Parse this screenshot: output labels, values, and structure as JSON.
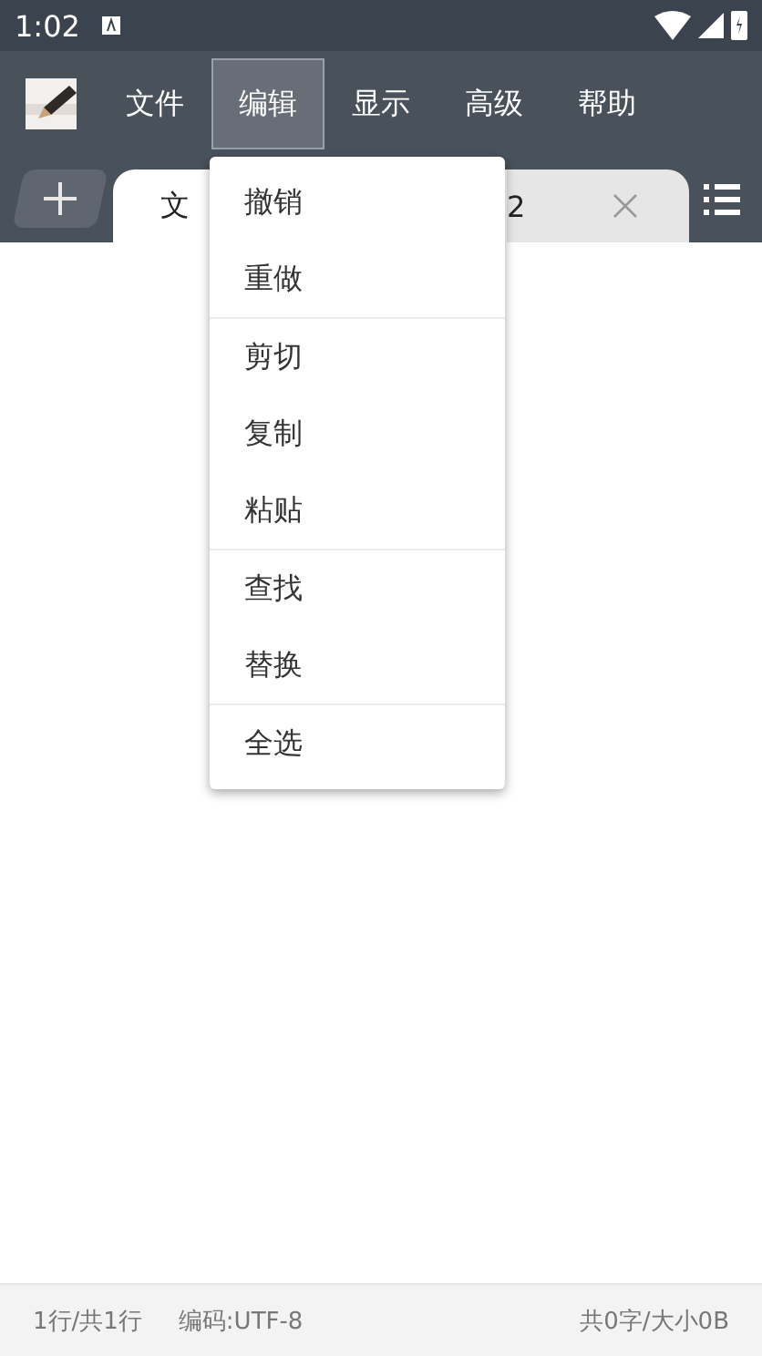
{
  "status_bar": {
    "time": "1:02"
  },
  "menu_bar": {
    "items": [
      {
        "label": "文件",
        "selected": false
      },
      {
        "label": "编辑",
        "selected": true
      },
      {
        "label": "显示",
        "selected": false
      },
      {
        "label": "高级",
        "selected": false
      },
      {
        "label": "帮助",
        "selected": false
      }
    ]
  },
  "tabs": [
    {
      "title": "文",
      "selected": true
    },
    {
      "title": "2",
      "selected": false
    }
  ],
  "dropdown_menu": {
    "groups": [
      [
        "撤销",
        "重做"
      ],
      [
        "剪切",
        "复制",
        "粘贴"
      ],
      [
        "查找",
        "替换"
      ],
      [
        "全选"
      ]
    ]
  },
  "footer": {
    "position": "1行/共1行",
    "encoding": "编码:UTF-8",
    "size": "共0字/大小0B"
  }
}
